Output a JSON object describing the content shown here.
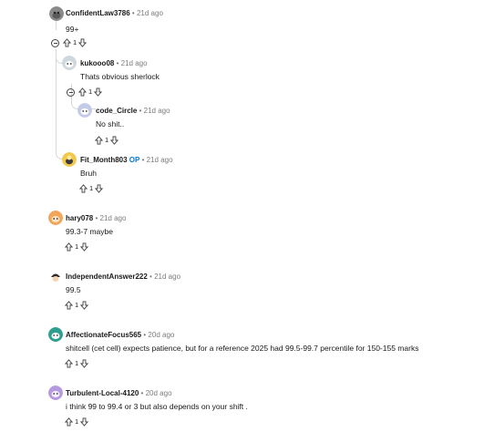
{
  "comments": [
    {
      "author": "ConfidentLaw3786",
      "op": "",
      "time": "21d ago",
      "body": "99+",
      "score": "1",
      "avatar_color": "#8a8a8a",
      "avatar_icon": "cat-avatar-icon"
    },
    {
      "author": "kukooo08",
      "op": "",
      "time": "21d ago",
      "body": "Thats obvious sherlock",
      "score": "1",
      "avatar_color": "#cfd8dc",
      "avatar_icon": "snoo-avatar-icon"
    },
    {
      "author": "code_Circle",
      "op": "",
      "time": "21d ago",
      "body": "No shit..",
      "score": "1",
      "avatar_color": "#c5cae9",
      "avatar_icon": "snoo-avatar-icon"
    },
    {
      "author": "Fit_Month803",
      "op": "OP",
      "time": "21d ago",
      "body": "Bruh",
      "score": "1",
      "avatar_color": "#f2c94c",
      "avatar_icon": "snoo-avatar-icon"
    },
    {
      "author": "hary078",
      "op": "",
      "time": "21d ago",
      "body": "99.3-7 maybe",
      "score": "1",
      "avatar_color": "#f2a65a",
      "avatar_icon": "snoo-avatar-icon"
    },
    {
      "author": "IndependentAnswer222",
      "op": "",
      "time": "21d ago",
      "body": "99.5",
      "score": "1",
      "avatar_color": "#ffffff",
      "avatar_icon": "snoo-avatar-icon"
    },
    {
      "author": "AffectionateFocus565",
      "op": "",
      "time": "20d ago",
      "body": "shitcell (cet cell) expects patience, but for a reference 2025 had 99.5-99.7 percentile for 150-155 marks",
      "score": "1",
      "avatar_color": "#2e9e8f",
      "avatar_icon": "snoo-avatar-icon"
    },
    {
      "author": "Turbulent-Local-4120",
      "op": "",
      "time": "20d ago",
      "body": "i think 99 to 99.4 or 3 but also depends on your shift .",
      "score": "1",
      "avatar_color": "#b69ae0",
      "avatar_icon": "snoo-avatar-icon"
    }
  ],
  "separator": "•"
}
